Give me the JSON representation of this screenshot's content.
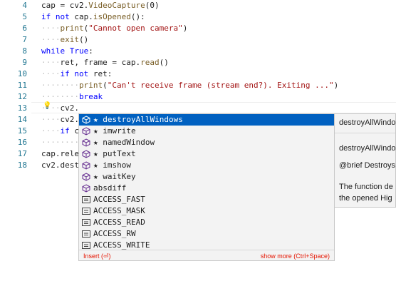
{
  "editor": {
    "line_numbers": [
      "4",
      "5",
      "6",
      "7",
      "8",
      "9",
      "10",
      "11",
      "12",
      "13",
      "14",
      "15",
      "16",
      "17",
      "18"
    ],
    "lines": [
      "cap = cv2.VideoCapture(0)",
      "if not cap.isOpened():",
      "    print(\"Cannot open camera\")",
      "    exit()",
      "while True:",
      "    ret, frame = cap.read()",
      "    if not ret:",
      "        print(\"Can't receive frame (stream end?). Exiting ...\")",
      "        break",
      "    cv2.",
      "    cv2.",
      "    if c",
      "        ",
      "cap.rele",
      "cv2.dest"
    ]
  },
  "suggest": {
    "items": [
      {
        "label": "★ destroyAllWindows",
        "icon": "method-icon",
        "selected": true
      },
      {
        "label": "★ imwrite",
        "icon": "method-icon"
      },
      {
        "label": "★ namedWindow",
        "icon": "method-icon"
      },
      {
        "label": "★ putText",
        "icon": "method-icon"
      },
      {
        "label": "★ imshow",
        "icon": "method-icon"
      },
      {
        "label": "★ waitKey",
        "icon": "method-icon"
      },
      {
        "label": "absdiff",
        "icon": "method-icon"
      },
      {
        "label": "ACCESS_FAST",
        "icon": "constant-icon"
      },
      {
        "label": "ACCESS_MASK",
        "icon": "constant-icon"
      },
      {
        "label": "ACCESS_READ",
        "icon": "constant-icon"
      },
      {
        "label": "ACCESS_RW",
        "icon": "constant-icon"
      },
      {
        "label": "ACCESS_WRITE",
        "icon": "constant-icon"
      }
    ],
    "footer_left": "Insert (⏎)",
    "footer_right": "show more (Ctrl+Space)"
  },
  "details": {
    "title": "destroyAllWindows",
    "signature": "destroyAllWindows",
    "brief": "@brief Destroys",
    "desc_1": "The function de",
    "desc_2": "the opened Hig"
  },
  "colors": {
    "selection": "#0060c0",
    "keyword": "#0000ff",
    "string": "#a31515",
    "line_number": "#237893",
    "footer_text": "#e51400"
  }
}
